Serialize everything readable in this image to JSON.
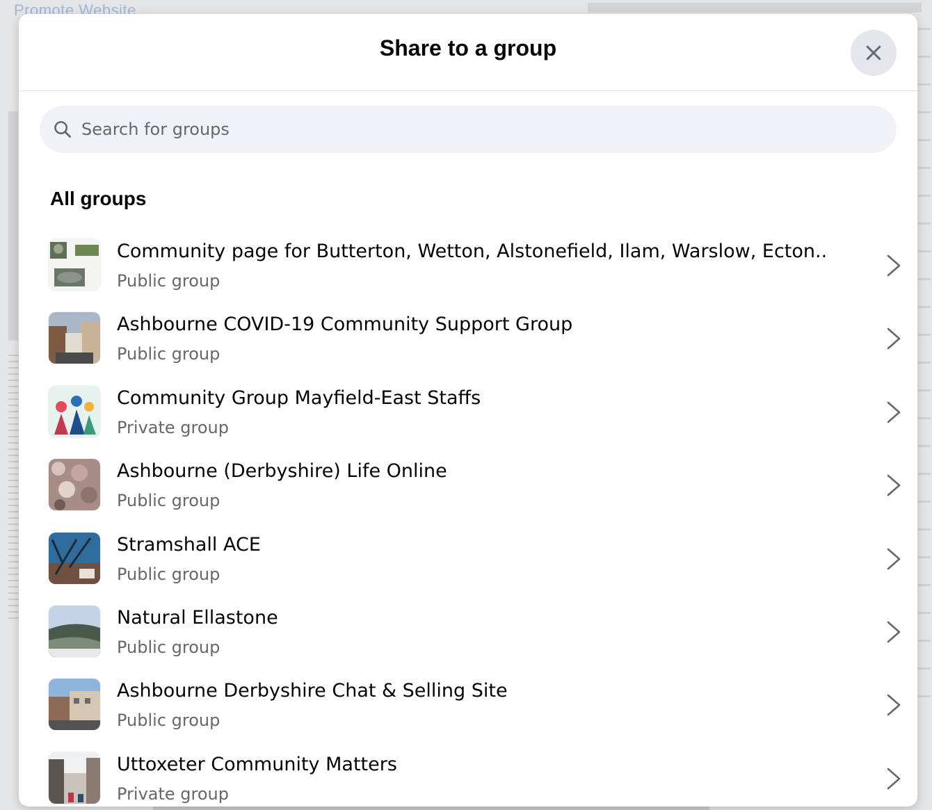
{
  "background": {
    "link_text": "Promote Website"
  },
  "modal": {
    "title": "Share to a group",
    "close_icon": "close-icon"
  },
  "search": {
    "placeholder": "Search for groups",
    "icon": "search-icon"
  },
  "section": {
    "heading": "All groups"
  },
  "groups": [
    {
      "name": "Community page for Butterton, Wetton, Alstonefield, Ilam, Warslow, Ecton..",
      "privacy": "Public group"
    },
    {
      "name": "Ashbourne COVID-19 Community Support Group",
      "privacy": "Public group"
    },
    {
      "name": "Community Group Mayfield-East Staffs",
      "privacy": "Private group"
    },
    {
      "name": "Ashbourne (Derbyshire) Life Online",
      "privacy": "Public group"
    },
    {
      "name": "Stramshall ACE",
      "privacy": "Public group"
    },
    {
      "name": "Natural Ellastone",
      "privacy": "Public group"
    },
    {
      "name": "Ashbourne Derbyshire Chat & Selling Site",
      "privacy": "Public group"
    },
    {
      "name": "Uttoxeter Community Matters",
      "privacy": "Private group"
    }
  ],
  "colors": {
    "primary_text": "#050505",
    "secondary_text": "#65676b",
    "search_bg": "#f0f2f5",
    "close_bg": "#e4e6eb"
  }
}
